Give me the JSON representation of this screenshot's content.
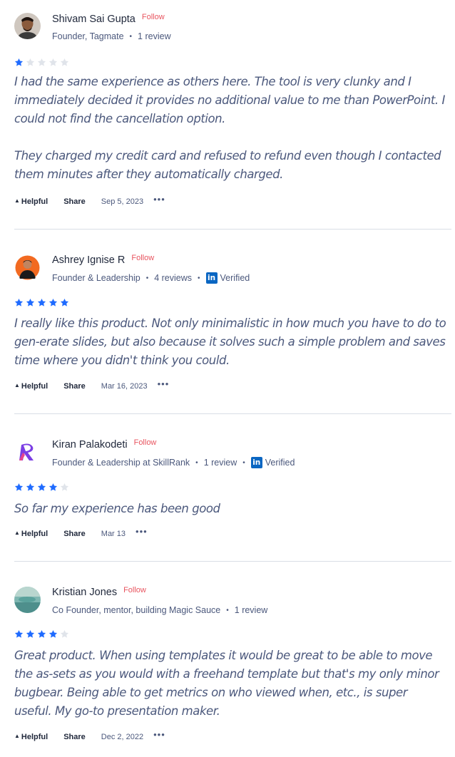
{
  "reviews": [
    {
      "name": "Shivam Sai Gupta",
      "follow": "Follow",
      "title": "Founder, Tagmate",
      "review_count": "1 review",
      "verified": "",
      "rating": 1,
      "max_rating": 5,
      "paragraphs": [
        "I had the same experience as others here. The tool is very clunky and I immediately decided it provides no additional value to me than PowerPoint. I could not find the cancellation option.",
        "They charged my credit card and refused to refund even though I contacted them minutes after they automatically charged."
      ],
      "helpful": "Helpful",
      "share": "Share",
      "date": "Sep 5, 2023",
      "more": "•••"
    },
    {
      "name": "Ashrey Ignise R",
      "follow": "Follow",
      "title": "Founder & Leadership",
      "review_count": "4 reviews",
      "verified": "Verified",
      "rating": 5,
      "max_rating": 5,
      "paragraphs": [
        "I really like this product. Not only minimalistic in how much you have to do to gen-erate slides, but also because it solves such a simple problem and saves time where you didn't think you could."
      ],
      "helpful": "Helpful",
      "share": "Share",
      "date": "Mar 16, 2023",
      "more": "•••"
    },
    {
      "name": "Kiran Palakodeti",
      "follow": "Follow",
      "title": "Founder & Leadership at SkillRank",
      "review_count": "1 review",
      "verified": "Verified",
      "rating": 4,
      "max_rating": 5,
      "paragraphs": [
        "So far my experience has been good"
      ],
      "helpful": "Helpful",
      "share": "Share",
      "date": "Mar 13",
      "more": "•••"
    },
    {
      "name": "Kristian Jones",
      "follow": "Follow",
      "title": "Co Founder, mentor, building Magic Sauce",
      "review_count": "1 review",
      "verified": "",
      "rating": 4,
      "max_rating": 5,
      "paragraphs": [
        "Great product. When using templates it would be great to be able to move the as-sets as you would with a freehand template but that's my only minor bugbear. Being able to get metrics on who viewed when, etc., is super useful. My go-to presentation maker."
      ],
      "helpful": "Helpful",
      "share": "Share",
      "date": "Dec 2, 2022",
      "more": "•••"
    }
  ],
  "colors": {
    "star_filled": "#1f6bff",
    "star_empty": "#e0e4ea",
    "follow": "#e8545f",
    "linkedin": "#0a66c2"
  },
  "icons": {
    "helpful": "upvote-triangle-icon",
    "linkedin": "linkedin-icon",
    "more": "more-dots-icon"
  },
  "linkedin_badge": "in",
  "helpful_glyph": "▲"
}
